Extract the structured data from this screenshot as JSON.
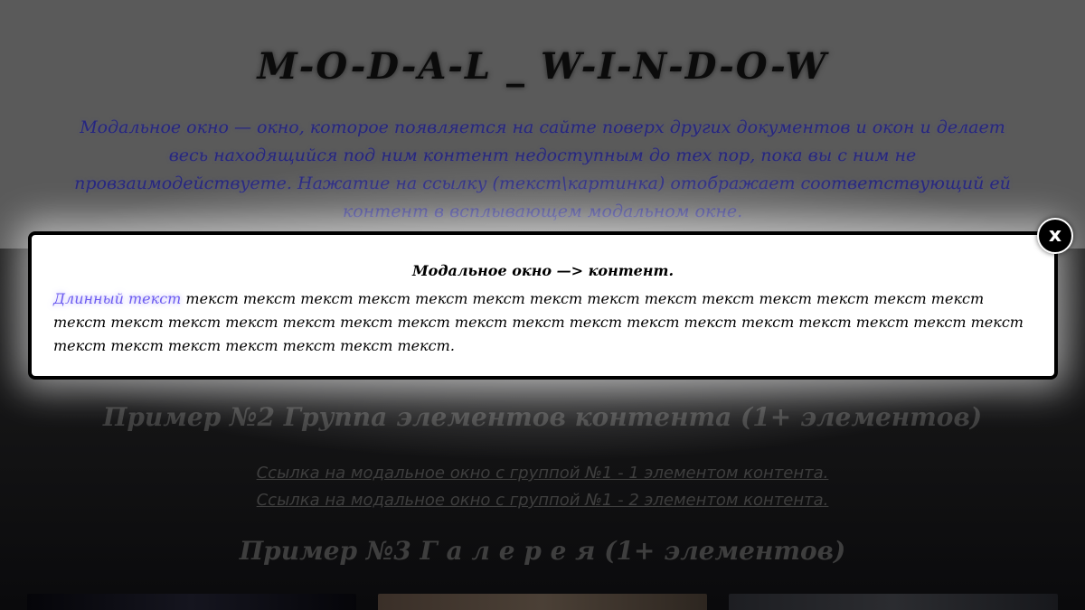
{
  "page": {
    "title": "M-O-D-A-L _ W-I-N-D-O-W",
    "description": "Модальное окно — окно, которое появляется на сайте поверх других документов и окон и делает весь находящийся под ним контент недоступным до тех пор, пока вы с ним не провзаимодействуете. Нажатие на ссылку (текст\\картинка) отображает соответствующий ей контент в всплывающем модальном окне.",
    "section2_heading": "Пример №2 Группа элементов контента (1+ элементов)",
    "section2_links": [
      "Ссылка на модальное окно с группой №1 - 1 элементом контента.",
      "Ссылка на модальное окно с группой №1 - 2 элементом контента."
    ],
    "section3_heading": "Пример №3 Г а л е р е я (1+ элементов)"
  },
  "modal": {
    "title": "Модальное окно —> контент.",
    "link_text": "Длинный текст",
    "body_text": " текст текст текст текст текст текст текст текст текст текст текст текст текст текст текст текст текст текст текст текст текст текст текст текст текст текст текст текст текст текст текст текст текст текст текст текст текст текст.",
    "close_label": "x"
  },
  "colors": {
    "accent_link": "#6b5bf0",
    "description_text": "#262680",
    "modal_border": "#000000"
  }
}
